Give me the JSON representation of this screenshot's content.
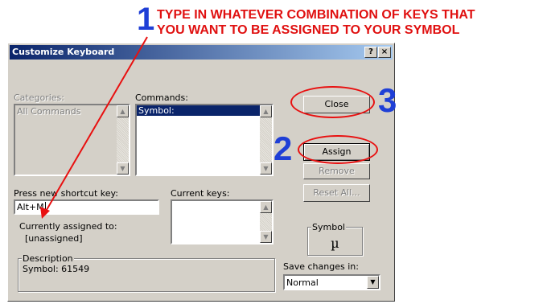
{
  "annotations": {
    "step1_number": "1",
    "step1_text_line1": "TYPE IN WHATEVER COMBINATION OF KEYS THAT",
    "step1_text_line2": "YOU WANT TO BE ASSIGNED TO YOUR SYMBOL",
    "step2_number": "2",
    "step3_number": "3",
    "colors": {
      "number": "#1f3fd6",
      "text": "#e01010",
      "ellipse": "#e81010"
    }
  },
  "dialog": {
    "title": "Customize Keyboard",
    "help_button": "?",
    "close_x": "×",
    "categories_label": "Categories:",
    "categories_items": [
      "All Commands"
    ],
    "commands_label": "Commands:",
    "commands_items": [
      "Symbol:"
    ],
    "press_shortcut_label": "Press new shortcut key:",
    "shortcut_value": "Alt+M",
    "current_keys_label": "Current keys:",
    "currently_assigned_label": "Currently assigned to:",
    "currently_assigned_value": "[unassigned]",
    "description_legend": "Description",
    "description_text": "Symbol: 61549",
    "symbol_legend": "Symbol",
    "symbol_char": "µ",
    "save_changes_label": "Save changes in:",
    "save_changes_value": "Normal",
    "buttons": {
      "close": "Close",
      "assign": "Assign",
      "remove": "Remove",
      "reset_all": "Reset All..."
    }
  }
}
